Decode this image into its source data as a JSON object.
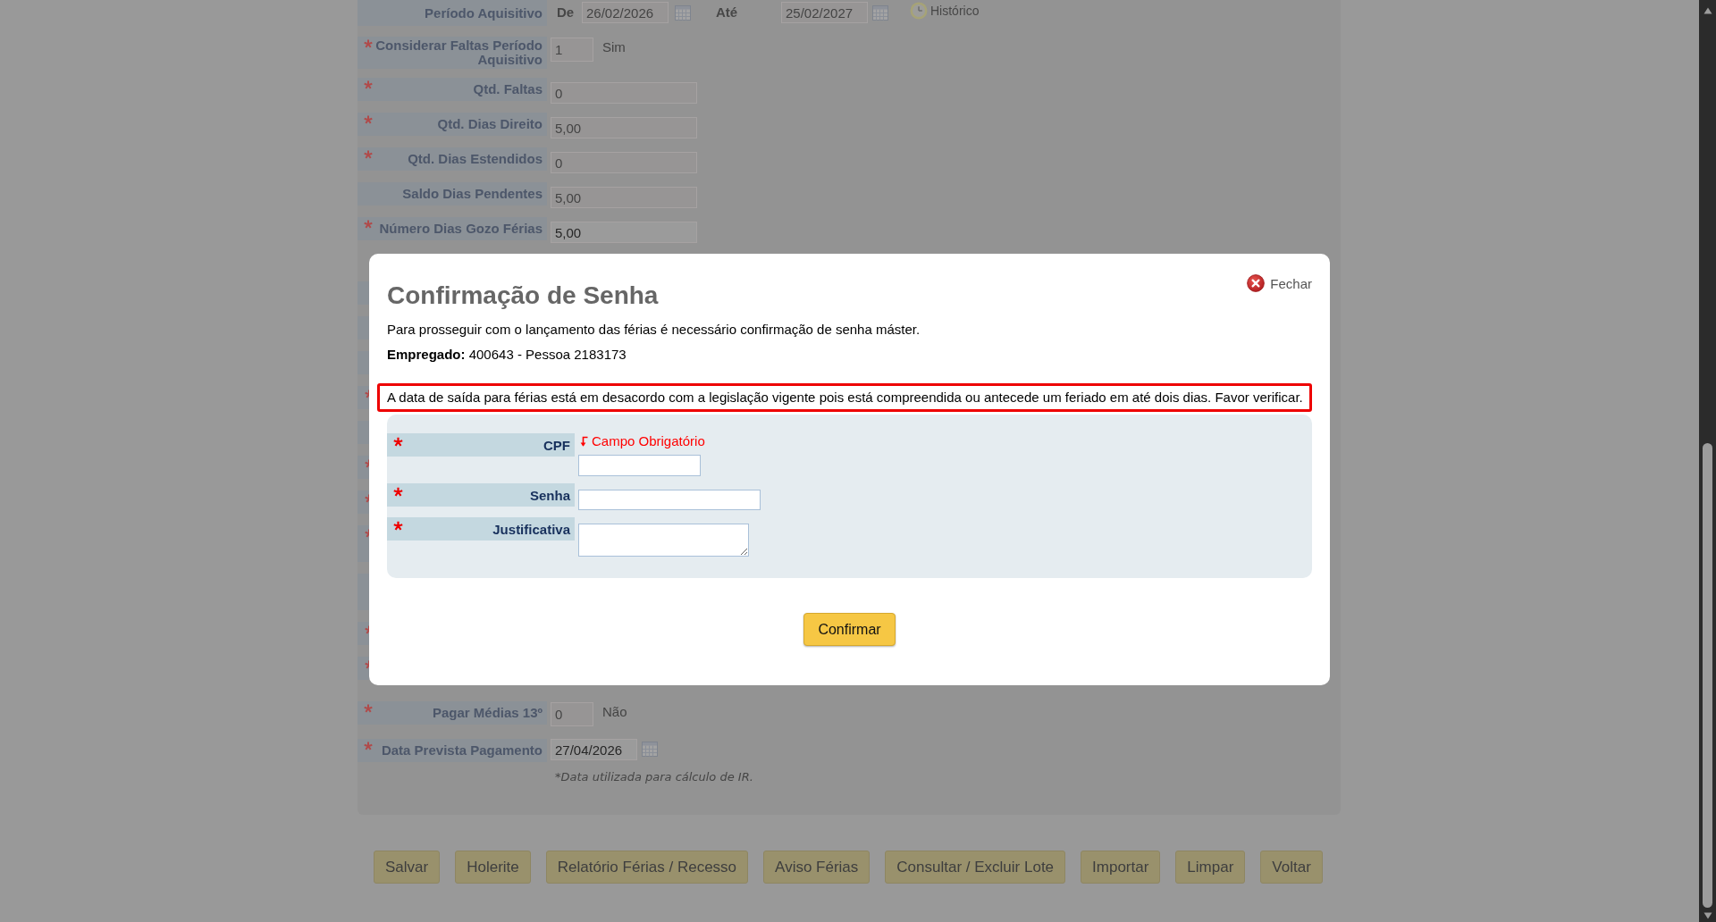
{
  "scrolled_page": {
    "period": {
      "label": "Período Aquisitivo",
      "required": false,
      "from_label": "De",
      "from": {
        "value": "26/02/2026",
        "disabled": true
      },
      "to_label": "Até",
      "to": {
        "value": "25/02/2027",
        "disabled": true
      },
      "history_link": "Histórico"
    },
    "fields": [
      {
        "kind": "flag",
        "label": "Considerar Faltas Período Aquisitivo",
        "required": true,
        "value": "1",
        "disabled": true,
        "note": "Sim"
      },
      {
        "kind": "text",
        "label": "Qtd. Faltas",
        "required": true,
        "value": "0",
        "disabled": true
      },
      {
        "kind": "text",
        "label": "Qtd. Dias Direito",
        "required": true,
        "value": "5,00",
        "disabled": true
      },
      {
        "kind": "text",
        "label": "Qtd. Dias Estendidos",
        "required": true,
        "value": "0",
        "disabled": true
      },
      {
        "kind": "text",
        "label": "Saldo Dias Pendentes",
        "required": false,
        "value": "5,00",
        "disabled": true
      },
      {
        "kind": "text",
        "label": "Número Dias Gozo Férias",
        "required": true,
        "value": "5,00",
        "disabled": false
      }
    ],
    "obscured_rows": [
      {
        "kind": "single",
        "required": false
      },
      {
        "kind": "single",
        "required": false
      },
      {
        "kind": "single",
        "required": false
      },
      {
        "kind": "single",
        "required": true
      },
      {
        "kind": "single",
        "required": false
      },
      {
        "kind": "single",
        "required": true
      },
      {
        "kind": "single",
        "required": true
      },
      {
        "kind": "double",
        "required": true
      },
      {
        "kind": "double",
        "required": false
      },
      {
        "kind": "single",
        "required": true
      },
      {
        "kind": "single",
        "required": true
      }
    ],
    "lower_fields": [
      {
        "kind": "flag",
        "label": "Pagar Médias 13º",
        "required": true,
        "value": "0",
        "disabled": true,
        "note": "Não"
      },
      {
        "kind": "date",
        "label": "Data Prevista Pagamento",
        "required": true,
        "value": "27/04/2026",
        "disabled": false,
        "hint": "*Data utilizada para cálculo de IR."
      }
    ],
    "actions": [
      "Salvar",
      "Holerite",
      "Relatório Férias / Recesso",
      "Aviso Férias",
      "Consultar / Excluir Lote",
      "Importar",
      "Limpar",
      "Voltar"
    ]
  },
  "modal": {
    "title": "Confirmação de Senha",
    "close_label": "Fechar",
    "intro": "Para prosseguir com o lançamento das férias é necessário confirmação de senha máster.",
    "employee": "**Empregado:** 400643 - Pessoa 2183173",
    "alert": "A data de saída para férias está em desacordo com a legislação vigente pois está compreendida ou antecede um feriado em até dois dias. Favor verificar.",
    "fields": [
      {
        "kind": "text",
        "label": "CPF",
        "required": true,
        "error": "Campo Obrigatório"
      },
      {
        "kind": "password",
        "label": "Senha",
        "required": true
      },
      {
        "kind": "textarea",
        "label": "Justificativa",
        "required": true
      }
    ],
    "confirm_button": "Confirmar"
  }
}
